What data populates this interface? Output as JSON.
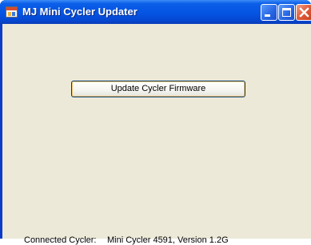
{
  "window": {
    "title": "MJ Mini Cycler Updater",
    "icon": "app-window-icon",
    "controls": {
      "minimize_icon": "minimize-icon",
      "maximize_icon": "maximize-icon",
      "close_icon": "close-icon"
    }
  },
  "main": {
    "update_button_label": "Update Cycler Firmware"
  },
  "status": {
    "label": "Connected Cycler:",
    "value": "Mini Cycler 4591, Version 1.2G"
  },
  "colors": {
    "titlebar": "#0554e3",
    "client_background": "#ece9d8",
    "close_button": "#e05a3a"
  }
}
